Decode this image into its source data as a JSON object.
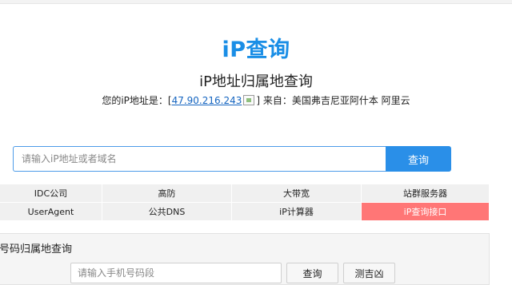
{
  "logo": {
    "text": "iP查询"
  },
  "heading": "iP地址归属地查询",
  "ip_info": {
    "prefix": "您的iP地址是：[",
    "ip": "47.90.216.243",
    "suffix": "] 来自：美国弗吉尼亚阿什本 阿里云"
  },
  "search": {
    "placeholder": "请输入iP地址或者域名",
    "value": "",
    "button_label": "查询"
  },
  "nav": {
    "items": [
      {
        "label": "IDC公司"
      },
      {
        "label": "高防"
      },
      {
        "label": "大带宽"
      },
      {
        "label": "站群服务器"
      },
      {
        "label": "UserAgent"
      },
      {
        "label": "公共DNS"
      },
      {
        "label": "iP计算器"
      },
      {
        "label": "iP查询接口"
      }
    ],
    "highlight_color": "#ff7676"
  },
  "phone": {
    "title": "机号码归属地查询",
    "placeholder": "请输入手机号码段",
    "query_label": "查询",
    "luck_label": "测吉凶"
  },
  "colors": {
    "brand": "#1a8ee6",
    "button": "#2a8fe8",
    "link": "#1565c0"
  }
}
